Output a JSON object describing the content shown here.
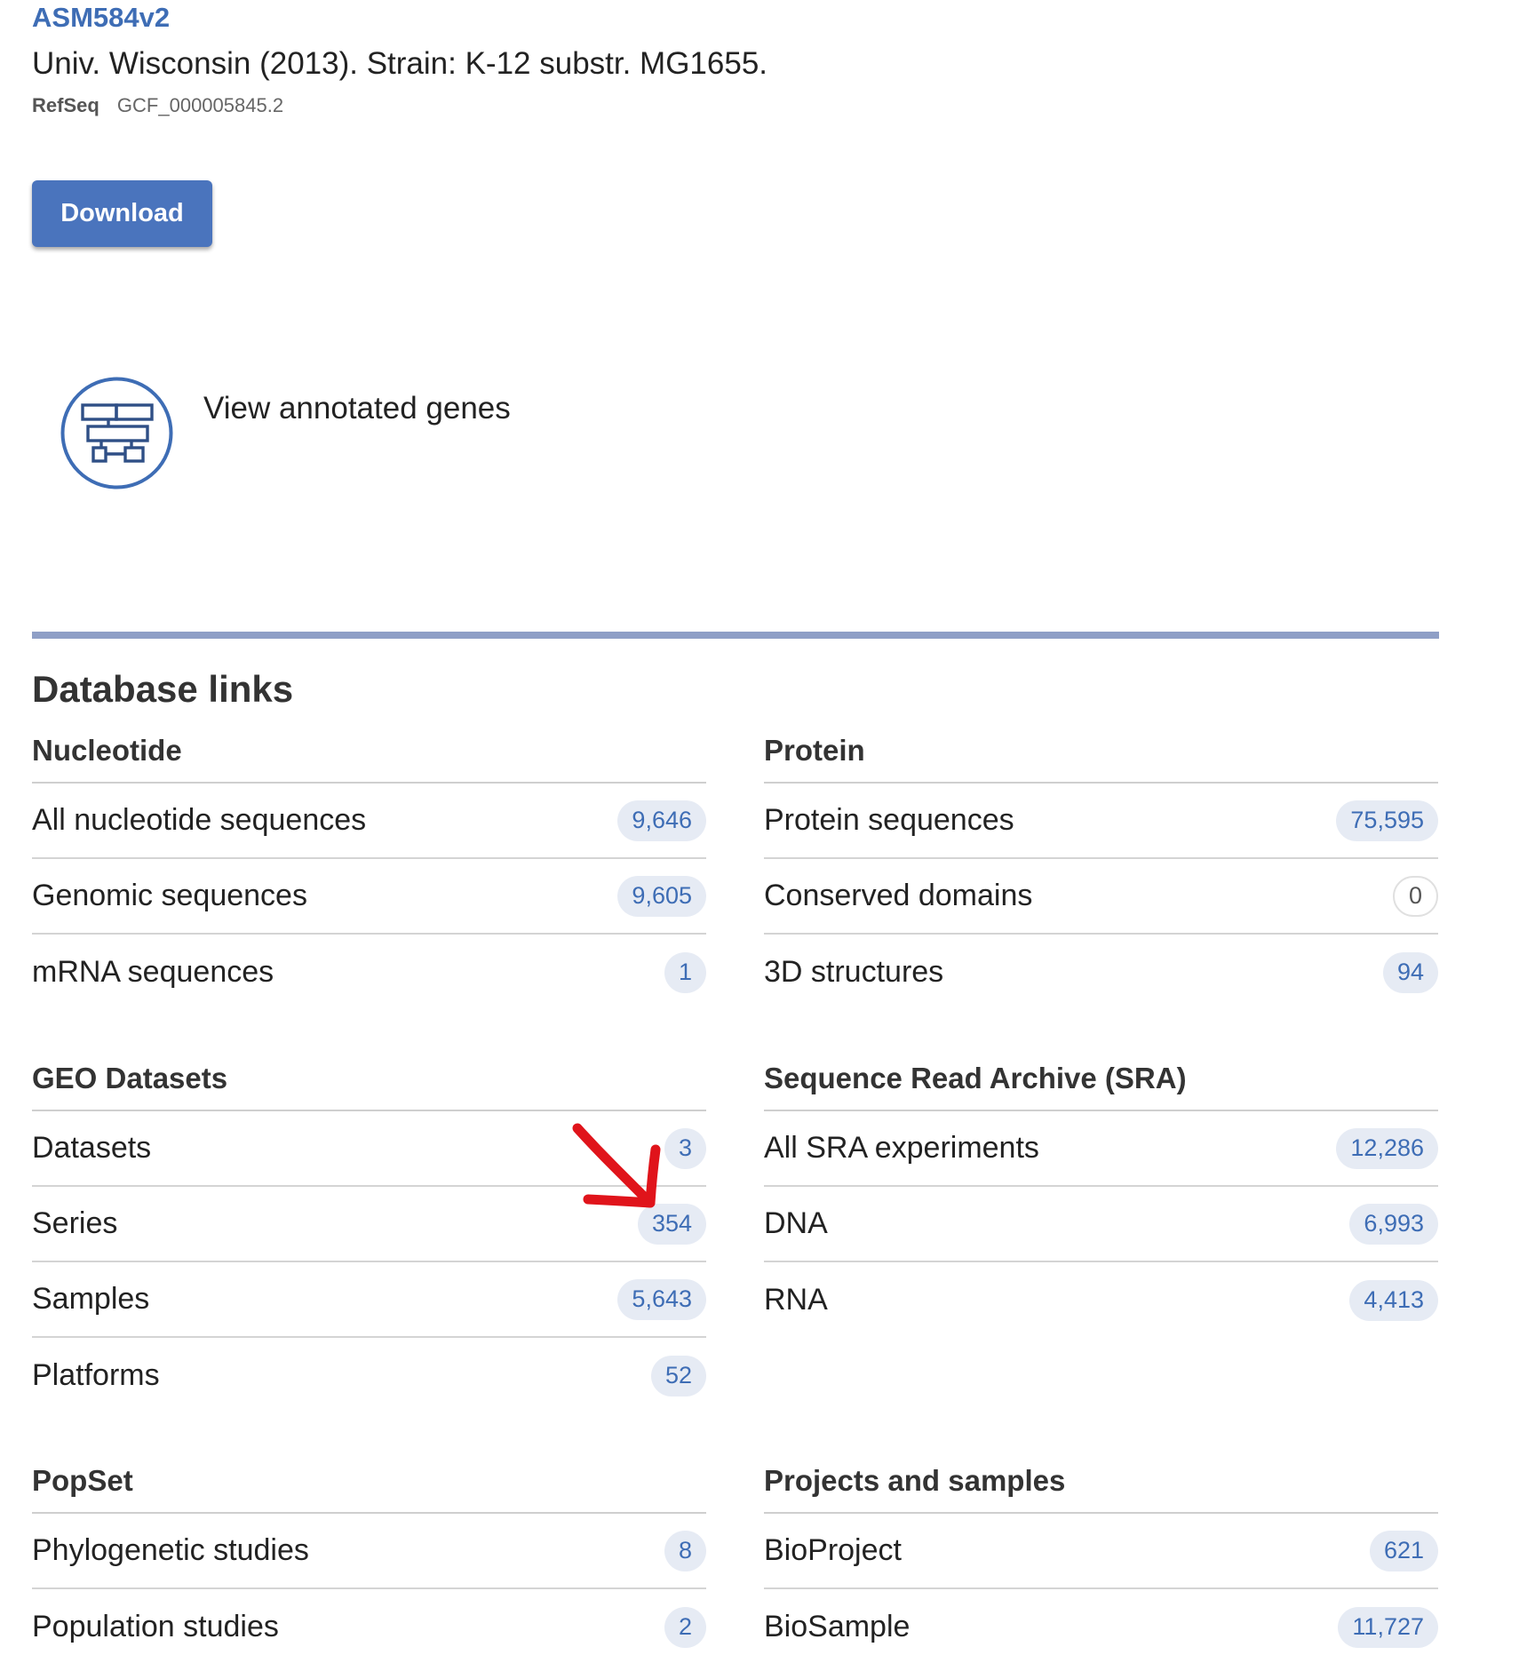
{
  "assembly": {
    "name": "ASM584v2",
    "description": "Univ. Wisconsin (2013). Strain: K-12 substr. MG1655.",
    "source_label": "RefSeq",
    "accession": "GCF_000005845.2"
  },
  "actions": {
    "download_label": "Download",
    "view_genes_label": "View annotated genes"
  },
  "database_links": {
    "title": "Database links",
    "nucleotide": {
      "heading": "Nucleotide",
      "rows": [
        {
          "label": "All nucleotide sequences",
          "count": "9,646"
        },
        {
          "label": "Genomic sequences",
          "count": "9,605"
        },
        {
          "label": "mRNA sequences",
          "count": "1"
        }
      ]
    },
    "protein": {
      "heading": "Protein",
      "rows": [
        {
          "label": "Protein sequences",
          "count": "75,595"
        },
        {
          "label": "Conserved domains",
          "count": "0"
        },
        {
          "label": "3D structures",
          "count": "94"
        }
      ]
    },
    "geo": {
      "heading": "GEO Datasets",
      "rows": [
        {
          "label": "Datasets",
          "count": "3"
        },
        {
          "label": "Series",
          "count": "354"
        },
        {
          "label": "Samples",
          "count": "5,643"
        },
        {
          "label": "Platforms",
          "count": "52"
        }
      ]
    },
    "sra": {
      "heading": "Sequence Read Archive (SRA)",
      "rows": [
        {
          "label": "All SRA experiments",
          "count": "12,286"
        },
        {
          "label": "DNA",
          "count": "6,993"
        },
        {
          "label": "RNA",
          "count": "4,413"
        }
      ]
    },
    "popset": {
      "heading": "PopSet",
      "rows": [
        {
          "label": "Phylogenetic studies",
          "count": "8"
        },
        {
          "label": "Population studies",
          "count": "2"
        }
      ]
    },
    "projects": {
      "heading": "Projects and samples",
      "rows": [
        {
          "label": "BioProject",
          "count": "621"
        },
        {
          "label": "BioSample",
          "count": "11,727"
        }
      ]
    }
  },
  "colors": {
    "accent": "#3e6db5",
    "button": "#4a74bd",
    "divider": "#8f9fc6",
    "badge_bg": "#e6ebf4",
    "annotation": "#e0141b"
  },
  "icons": {
    "genes": "gene-structure-icon",
    "annotation": "red-arrow-annotation"
  }
}
